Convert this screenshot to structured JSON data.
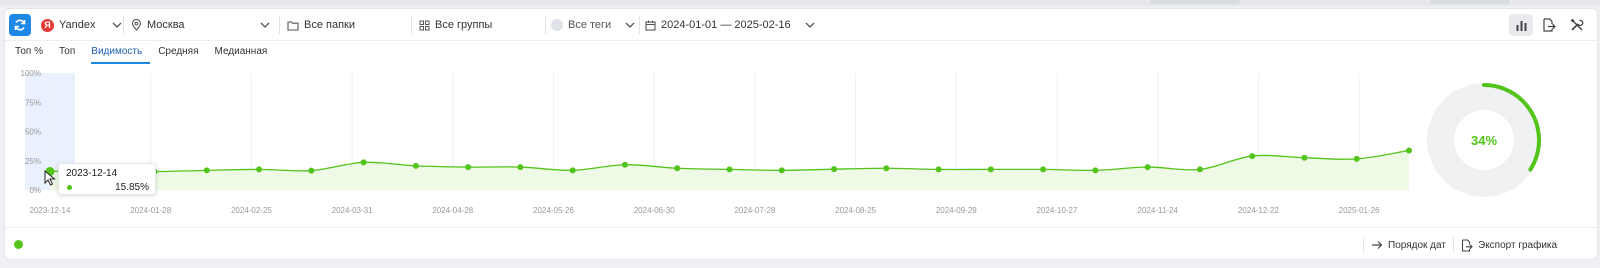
{
  "toolbar": {
    "search_engine": "Yandex",
    "search_engine_icon": "Я",
    "region": "Москва",
    "folders": "Все папки",
    "groups": "Все группы",
    "tags": "Все теги",
    "date_range": "2024-01-01 — 2025-02-16"
  },
  "tabs": [
    "Топ %",
    "Топ",
    "Видимость",
    "Средняя",
    "Медианная"
  ],
  "active_tab": "Видимость",
  "tooltip": {
    "date": "2023-12-14",
    "value": "15.85%"
  },
  "donut": {
    "label": "34%",
    "percent": 34,
    "color": "#52c41a"
  },
  "footer": {
    "date_order": "Порядок дат",
    "export_chart": "Экспорт графика"
  },
  "colors": {
    "accent": "#1e88e5",
    "series": "#52c41a",
    "series_fill": "#eef9e6"
  },
  "chart_data": {
    "type": "area",
    "y_ticks": [
      "100%",
      "75%",
      "50%",
      "25%",
      "0%"
    ],
    "ylim": [
      0,
      100
    ],
    "x_ticks": [
      "2023-12-14",
      "2024-01-28",
      "2024-02-25",
      "2024-03-31",
      "2024-04-28",
      "2024-05-26",
      "2024-06-30",
      "2024-07-28",
      "2024-08-25",
      "2024-09-29",
      "2024-10-27",
      "2024-11-24",
      "2024-12-22",
      "2025-01-26"
    ],
    "grid": true,
    "series": [
      {
        "values": [
          15.85,
          16.8,
          15.8,
          16.8,
          17.6,
          16.6,
          23.6,
          20.6,
          19.6,
          19.6,
          16.8,
          21.6,
          18.6,
          17.6,
          16.8,
          17.8,
          18.6,
          17.6,
          17.6,
          17.6,
          16.8,
          19.6,
          17.6,
          29,
          27.6,
          26.6,
          33.8
        ]
      }
    ]
  }
}
